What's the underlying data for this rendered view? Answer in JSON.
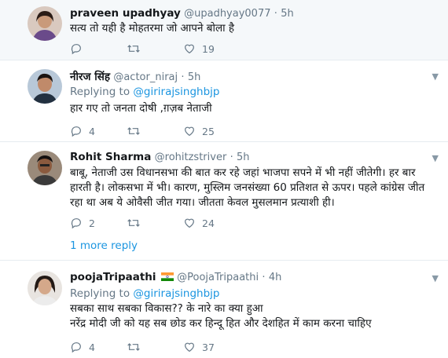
{
  "colors": {
    "link": "#1b95e0",
    "muted": "#657786",
    "shade": "#f5f8fa"
  },
  "tweets": [
    {
      "name": "praveen upadhyay",
      "handle": "@upadhyay0077",
      "sep": "·",
      "time": "5h",
      "replying_prefix": "",
      "replying_handle": "",
      "lines": [
        "सत्य तो यही है मोहतरमा जो आपने बोला है"
      ],
      "reply_count": "",
      "retweet_count": "",
      "like_count": "19"
    },
    {
      "name": "नीरज सिंह",
      "handle": "@actor_niraj",
      "sep": "·",
      "time": "5h",
      "replying_prefix": "Replying to ",
      "replying_handle": "@girirajsinghbjp",
      "lines": [
        "हार गए तो जनता दोषी ,ग़ज़ब नेताजी"
      ],
      "reply_count": "4",
      "retweet_count": "",
      "like_count": "25"
    },
    {
      "name": "Rohit Sharma",
      "handle": "@rohitzstriver",
      "sep": "·",
      "time": "5h",
      "replying_prefix": "",
      "replying_handle": "",
      "lines": [
        "बाबू, नेताजी उस विधानसभा की बात कर रहे जहां भाजपा सपने में भी नहीं जीतेगी। हर बार",
        "हारती है। लोकसभा में भी। कारण, मुस्लिम जनसंख्या 60 प्रतिशत से ऊपर। पहले कांग्रेस जीत",
        "रहा था अब ये ओवैसी जीत गया। जीतता केवल मुसलमान प्रत्याशी ही।"
      ],
      "reply_count": "2",
      "retweet_count": "",
      "like_count": "24"
    },
    {
      "name": "poojaTripaathi",
      "handle": "@PoojaTripaathi",
      "sep": "·",
      "time": "4h",
      "replying_prefix": "Replying to ",
      "replying_handle": "@girirajsinghbjp",
      "lines": [
        "सबका साथ सबका विकास?? के नारे का क्या हुआ",
        "नरेंद्र मोदी जी को यह सब छोड कर हिन्दू हित और देशहित में काम करना चाहिए"
      ],
      "reply_count": "4",
      "retweet_count": "",
      "like_count": "37"
    }
  ],
  "more_replies": "1 more reply"
}
